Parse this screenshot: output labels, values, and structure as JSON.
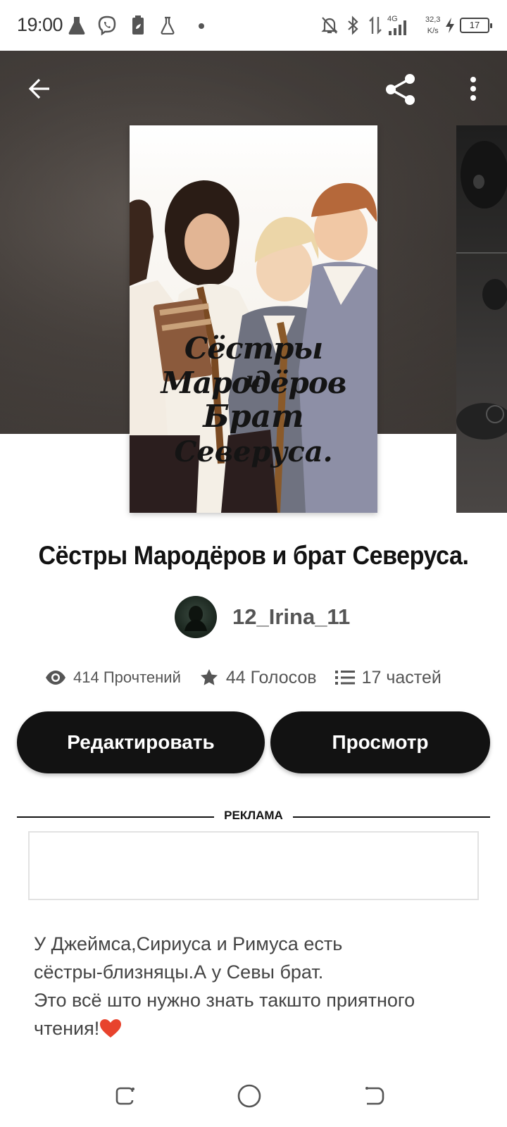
{
  "status_bar": {
    "time": "19:00",
    "network": "4G",
    "speed_value": "32,3",
    "speed_unit": "K/s",
    "battery": "17"
  },
  "toolbar": {
    "back_icon": "arrow-left-icon",
    "share_icon": "share-icon",
    "more_icon": "more-vertical-icon"
  },
  "cover": {
    "line1": "Сёстры Мародёров",
    "line2": "и",
    "line3": "Брат",
    "line4": "Северуса."
  },
  "story": {
    "title": "Сёстры Мародёров и брат Северуса.",
    "author": "12_Irina_11"
  },
  "stats": {
    "reads": "414 Прочтений",
    "votes": "44 Голосов",
    "parts": "17 частей"
  },
  "buttons": {
    "edit": "Редактировать",
    "preview": "Просмотр"
  },
  "ad": {
    "label": "РЕКЛАМА"
  },
  "description": {
    "line1": "У Джеймса,Сириуса и Римуса есть",
    "line2": "сёстры-близняцы.А у Севы брат.",
    "line3": "Это всё што нужно знать такшто приятного",
    "line4": "чтения!"
  },
  "colors": {
    "button_bg": "#121212",
    "heart": "#e8432d"
  }
}
